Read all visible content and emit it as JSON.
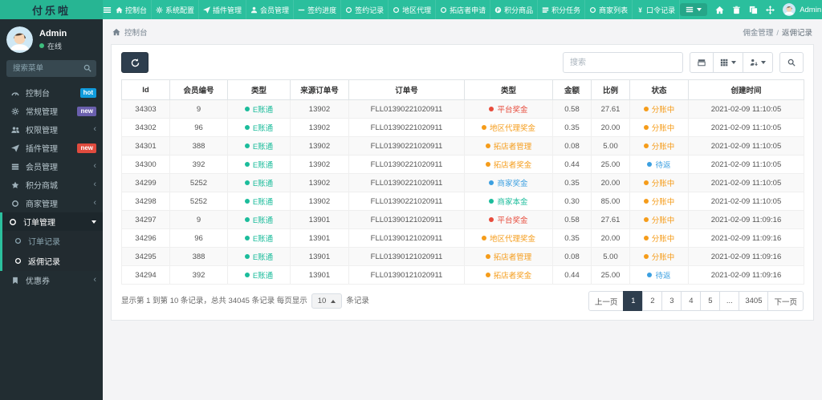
{
  "topbar": {
    "brand": "付乐啦",
    "menu": [
      {
        "icon": "home",
        "label": "控制台"
      },
      {
        "icon": "gear",
        "label": "系统配置"
      },
      {
        "icon": "send",
        "label": "插件管理"
      },
      {
        "icon": "user",
        "label": "会员管理"
      },
      {
        "icon": "minus",
        "label": "签约进度"
      },
      {
        "icon": "circle",
        "label": "签约记录"
      },
      {
        "icon": "circle",
        "label": "地区代理"
      },
      {
        "icon": "circle",
        "label": "拓店者申请"
      },
      {
        "icon": "pcircle",
        "label": "积分商品"
      },
      {
        "icon": "tasks",
        "label": "积分任务"
      },
      {
        "icon": "circle",
        "label": "商家列表"
      },
      {
        "icon": "yen",
        "label": "口令记录"
      }
    ],
    "user": "Admin"
  },
  "sidebar": {
    "user": {
      "name": "Admin",
      "status": "在线"
    },
    "search_placeholder": "搜索菜单",
    "items": [
      {
        "icon": "gauge",
        "label": "控制台",
        "badge": {
          "text": "hot",
          "color": "blue"
        }
      },
      {
        "icon": "gear",
        "label": "常规管理",
        "badge": {
          "text": "new",
          "color": "purple"
        }
      },
      {
        "icon": "users",
        "label": "权限管理",
        "arrow": true
      },
      {
        "icon": "send",
        "label": "插件管理",
        "badge": {
          "text": "new",
          "color": "red"
        }
      },
      {
        "icon": "table",
        "label": "会员管理",
        "arrow": true
      },
      {
        "icon": "star",
        "label": "积分商城",
        "arrow": true
      },
      {
        "icon": "circle",
        "label": "商家管理",
        "arrow": true
      },
      {
        "icon": "circle",
        "label": "订单管理",
        "expanded": true,
        "children": [
          {
            "icon": "circle",
            "label": "订单记录"
          },
          {
            "icon": "circle",
            "label": "返佣记录",
            "active": true
          }
        ]
      },
      {
        "icon": "bookmark",
        "label": "优惠券",
        "arrow": true
      }
    ]
  },
  "breadcrumb": {
    "left": "控制台",
    "right_parent": "佣金管理",
    "right_current": "返佣记录"
  },
  "toolbar": {
    "search_placeholder": "搜索"
  },
  "table": {
    "columns": [
      "Id",
      "会员编号",
      "类型",
      "来源订单号",
      "订单号",
      "类型",
      "金额",
      "比例",
      "状态",
      "创建时间"
    ],
    "rows": [
      {
        "id": "34303",
        "member": "9",
        "type1": "E账通",
        "source": "13902",
        "order": "FLL01390221020911",
        "type2": {
          "text": "平台奖金",
          "color": "red"
        },
        "amount": "0.58",
        "ratio": "27.61",
        "status": {
          "text": "分账中",
          "color": "orange"
        },
        "created": "2021-02-09 11:10:05"
      },
      {
        "id": "34302",
        "member": "96",
        "type1": "E账通",
        "source": "13902",
        "order": "FLL01390221020911",
        "type2": {
          "text": "地区代理奖金",
          "color": "orange"
        },
        "amount": "0.35",
        "ratio": "20.00",
        "status": {
          "text": "分账中",
          "color": "orange"
        },
        "created": "2021-02-09 11:10:05"
      },
      {
        "id": "34301",
        "member": "388",
        "type1": "E账通",
        "source": "13902",
        "order": "FLL01390221020911",
        "type2": {
          "text": "拓店者管理",
          "color": "orange"
        },
        "amount": "0.08",
        "ratio": "5.00",
        "status": {
          "text": "分账中",
          "color": "orange"
        },
        "created": "2021-02-09 11:10:05"
      },
      {
        "id": "34300",
        "member": "392",
        "type1": "E账通",
        "source": "13902",
        "order": "FLL01390221020911",
        "type2": {
          "text": "拓店者奖金",
          "color": "orange"
        },
        "amount": "0.44",
        "ratio": "25.00",
        "status": {
          "text": "待返",
          "color": "blue"
        },
        "created": "2021-02-09 11:10:05"
      },
      {
        "id": "34299",
        "member": "5252",
        "type1": "E账通",
        "source": "13902",
        "order": "FLL01390221020911",
        "type2": {
          "text": "商家奖金",
          "color": "blue"
        },
        "amount": "0.35",
        "ratio": "20.00",
        "status": {
          "text": "分账中",
          "color": "orange"
        },
        "created": "2021-02-09 11:10:05"
      },
      {
        "id": "34298",
        "member": "5252",
        "type1": "E账通",
        "source": "13902",
        "order": "FLL01390221020911",
        "type2": {
          "text": "商家本金",
          "color": "teal"
        },
        "amount": "0.30",
        "ratio": "85.00",
        "status": {
          "text": "分账中",
          "color": "orange"
        },
        "created": "2021-02-09 11:10:05"
      },
      {
        "id": "34297",
        "member": "9",
        "type1": "E账通",
        "source": "13901",
        "order": "FLL01390121020911",
        "type2": {
          "text": "平台奖金",
          "color": "red"
        },
        "amount": "0.58",
        "ratio": "27.61",
        "status": {
          "text": "分账中",
          "color": "orange"
        },
        "created": "2021-02-09 11:09:16"
      },
      {
        "id": "34296",
        "member": "96",
        "type1": "E账通",
        "source": "13901",
        "order": "FLL01390121020911",
        "type2": {
          "text": "地区代理奖金",
          "color": "orange"
        },
        "amount": "0.35",
        "ratio": "20.00",
        "status": {
          "text": "分账中",
          "color": "orange"
        },
        "created": "2021-02-09 11:09:16"
      },
      {
        "id": "34295",
        "member": "388",
        "type1": "E账通",
        "source": "13901",
        "order": "FLL01390121020911",
        "type2": {
          "text": "拓店者管理",
          "color": "orange"
        },
        "amount": "0.08",
        "ratio": "5.00",
        "status": {
          "text": "分账中",
          "color": "orange"
        },
        "created": "2021-02-09 11:09:16"
      },
      {
        "id": "34294",
        "member": "392",
        "type1": "E账通",
        "source": "13901",
        "order": "FLL01390121020911",
        "type2": {
          "text": "拓店者奖金",
          "color": "orange"
        },
        "amount": "0.44",
        "ratio": "25.00",
        "status": {
          "text": "待返",
          "color": "blue"
        },
        "created": "2021-02-09 11:09:16"
      }
    ]
  },
  "footer": {
    "summary_prefix": "显示第 1 到第 10 条记录，总共 34045 条记录 每页显示",
    "page_size": "10",
    "summary_suffix": "条记录",
    "pagination": [
      {
        "text": "上一页"
      },
      {
        "text": "1",
        "active": true
      },
      {
        "text": "2"
      },
      {
        "text": "3"
      },
      {
        "text": "4"
      },
      {
        "text": "5"
      },
      {
        "text": "..."
      },
      {
        "text": "3405"
      },
      {
        "text": "下一页"
      }
    ]
  },
  "palette": {
    "accent": "#2bbf9d",
    "navy": "#2e3e4e",
    "red": "#e74c3c",
    "orange": "#f59c1a",
    "blue": "#3b9fe0",
    "teal": "#1bbc9b",
    "green": "#3dbd7d"
  }
}
